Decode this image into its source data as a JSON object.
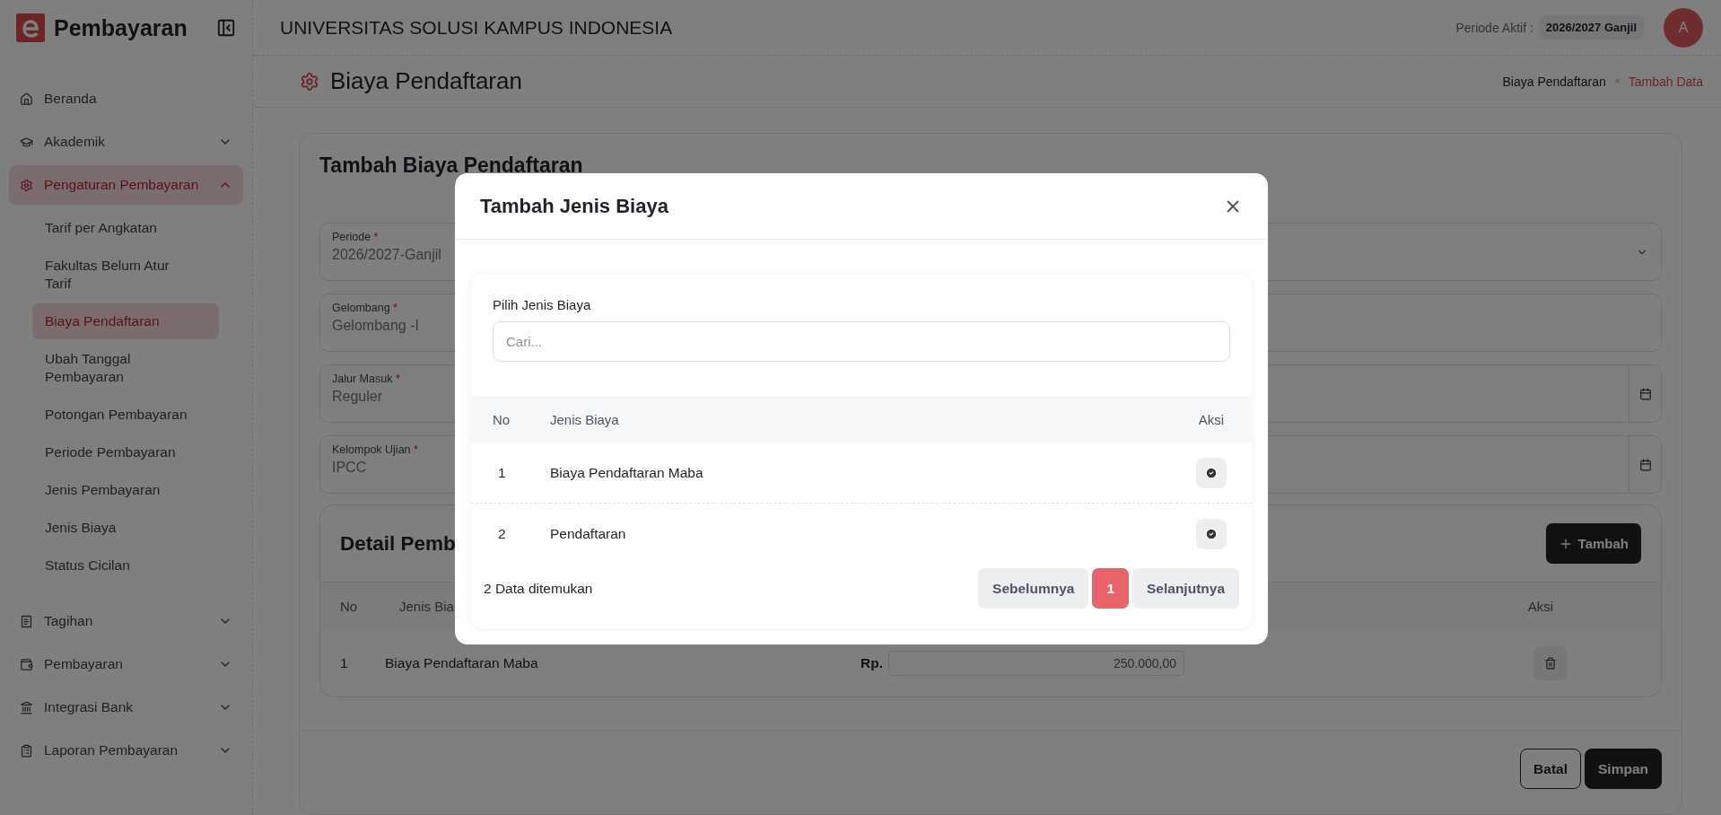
{
  "sidebar": {
    "brand": "Pembayaran",
    "items": [
      {
        "label": "Beranda",
        "kind": "link",
        "selected": false
      },
      {
        "label": "Akademik",
        "kind": "group",
        "expanded": false,
        "selected": false
      },
      {
        "label": "Pengaturan Pembayaran",
        "kind": "group",
        "expanded": true,
        "selected": true,
        "children": [
          {
            "label": "Tarif per Angkatan",
            "selected": false
          },
          {
            "label": "Fakultas Belum Atur Tarif",
            "selected": false
          },
          {
            "label": "Biaya Pendaftaran",
            "selected": true
          },
          {
            "label": "Ubah Tanggal Pembayaran",
            "selected": false
          },
          {
            "label": "Potongan Pembayaran",
            "selected": false
          },
          {
            "label": "Periode Pembayaran",
            "selected": false
          },
          {
            "label": "Jenis Pembayaran",
            "selected": false
          },
          {
            "label": "Jenis Biaya",
            "selected": false
          },
          {
            "label": "Status Cicilan",
            "selected": false
          }
        ]
      },
      {
        "label": "Tagihan",
        "kind": "group",
        "expanded": false,
        "selected": false
      },
      {
        "label": "Pembayaran",
        "kind": "group",
        "expanded": false,
        "selected": false
      },
      {
        "label": "Integrasi Bank",
        "kind": "group",
        "expanded": false,
        "selected": false
      },
      {
        "label": "Laporan Pembayaran",
        "kind": "group",
        "expanded": false,
        "selected": false
      }
    ]
  },
  "header": {
    "title": "UNIVERSITAS SOLUSI KAMPUS INDONESIA",
    "period_label": "Periode Aktif :",
    "period_value": "2026/2027 Ganjil",
    "avatar": "A"
  },
  "page": {
    "title": "Biaya Pendaftaran",
    "breadcrumb": [
      {
        "label": "Biaya Pendaftaran",
        "selected": false
      },
      {
        "label": "Tambah Data",
        "selected": true
      }
    ]
  },
  "form": {
    "title": "Tambah Biaya Pendaftaran",
    "fields": [
      {
        "label": "Periode",
        "required_mark": "*",
        "value": "2026/2027-Ganjil",
        "kind": "select"
      },
      {
        "label": "Gelombang",
        "required_mark": "*",
        "value": "Gelombang -I",
        "kind": "text"
      },
      {
        "label": "Jalur Masuk",
        "required_mark": "*",
        "value": "Reguler",
        "kind": "date"
      },
      {
        "label": "Kelompok Ujian",
        "required_mark": "*",
        "value": "IPCC",
        "kind": "date"
      }
    ],
    "detail": {
      "title": "Detail Pemb",
      "add_button": "Tambah",
      "columns": [
        "No",
        "Jenis Bia",
        "Aksi"
      ],
      "rows": [
        {
          "no": "1",
          "name": "Biaya Pendaftaran Maba",
          "currency": "Rp.",
          "amount": "250.000,00"
        }
      ]
    },
    "buttons": [
      {
        "label": "Batal",
        "kind": "outline"
      },
      {
        "label": "Simpan",
        "kind": "solid"
      }
    ]
  },
  "modal": {
    "title": "Tambah Jenis Biaya",
    "search_label": "Pilih Jenis Biaya",
    "search_placeholder": "Cari...",
    "columns": [
      "No",
      "Jenis Biaya",
      "Aksi"
    ],
    "rows": [
      {
        "no": "1",
        "name": "Biaya Pendaftaran Maba"
      },
      {
        "no": "2",
        "name": "Pendaftaran"
      }
    ],
    "count": "2 Data ditemukan",
    "prev": "Sebelumnya",
    "next": "Selanjutnya",
    "pages": [
      {
        "label": "1",
        "selected": true
      }
    ]
  }
}
